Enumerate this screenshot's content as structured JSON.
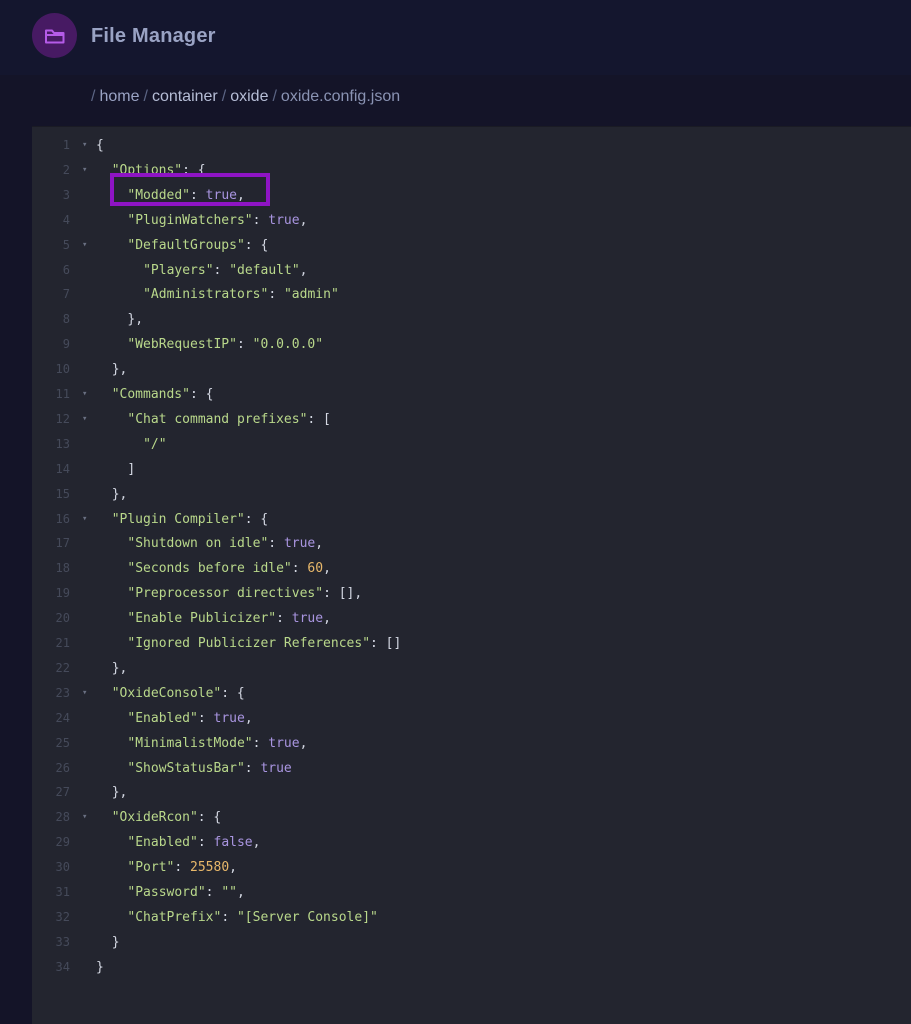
{
  "header": {
    "title": "File Manager",
    "icon": "folder-icon",
    "accent_color": "#471a63"
  },
  "breadcrumb": {
    "items": [
      "home",
      "container",
      "oxide"
    ],
    "current": "oxide.config.json",
    "separator": "/"
  },
  "editor": {
    "lines": [
      {
        "n": "1",
        "fold": true,
        "indent": 0,
        "tokens": [
          [
            "p",
            "{"
          ]
        ]
      },
      {
        "n": "2",
        "fold": true,
        "indent": 1,
        "tokens": [
          [
            "k",
            "\"Options\""
          ],
          [
            "p",
            ": {"
          ]
        ]
      },
      {
        "n": "3",
        "fold": false,
        "indent": 2,
        "tokens": [
          [
            "k",
            "\"Modded\""
          ],
          [
            "p",
            ": "
          ],
          [
            "b",
            "true"
          ],
          [
            "p",
            ","
          ]
        ]
      },
      {
        "n": "4",
        "fold": false,
        "indent": 2,
        "tokens": [
          [
            "k",
            "\"PluginWatchers\""
          ],
          [
            "p",
            ": "
          ],
          [
            "b",
            "true"
          ],
          [
            "p",
            ","
          ]
        ]
      },
      {
        "n": "5",
        "fold": true,
        "indent": 2,
        "tokens": [
          [
            "k",
            "\"DefaultGroups\""
          ],
          [
            "p",
            ": {"
          ]
        ]
      },
      {
        "n": "6",
        "fold": false,
        "indent": 3,
        "tokens": [
          [
            "k",
            "\"Players\""
          ],
          [
            "p",
            ": "
          ],
          [
            "s",
            "\"default\""
          ],
          [
            "p",
            ","
          ]
        ]
      },
      {
        "n": "7",
        "fold": false,
        "indent": 3,
        "tokens": [
          [
            "k",
            "\"Administrators\""
          ],
          [
            "p",
            ": "
          ],
          [
            "s",
            "\"admin\""
          ]
        ]
      },
      {
        "n": "8",
        "fold": false,
        "indent": 2,
        "tokens": [
          [
            "p",
            "},"
          ]
        ]
      },
      {
        "n": "9",
        "fold": false,
        "indent": 2,
        "tokens": [
          [
            "k",
            "\"WebRequestIP\""
          ],
          [
            "p",
            ": "
          ],
          [
            "s",
            "\"0.0.0.0\""
          ]
        ]
      },
      {
        "n": "10",
        "fold": false,
        "indent": 1,
        "tokens": [
          [
            "p",
            "},"
          ]
        ]
      },
      {
        "n": "11",
        "fold": true,
        "indent": 1,
        "tokens": [
          [
            "k",
            "\"Commands\""
          ],
          [
            "p",
            ": {"
          ]
        ]
      },
      {
        "n": "12",
        "fold": true,
        "indent": 2,
        "tokens": [
          [
            "k",
            "\"Chat command prefixes\""
          ],
          [
            "p",
            ": ["
          ]
        ]
      },
      {
        "n": "13",
        "fold": false,
        "indent": 3,
        "tokens": [
          [
            "s",
            "\"/\""
          ]
        ]
      },
      {
        "n": "14",
        "fold": false,
        "indent": 2,
        "tokens": [
          [
            "p",
            "]"
          ]
        ]
      },
      {
        "n": "15",
        "fold": false,
        "indent": 1,
        "tokens": [
          [
            "p",
            "},"
          ]
        ]
      },
      {
        "n": "16",
        "fold": true,
        "indent": 1,
        "tokens": [
          [
            "k",
            "\"Plugin Compiler\""
          ],
          [
            "p",
            ": {"
          ]
        ]
      },
      {
        "n": "17",
        "fold": false,
        "indent": 2,
        "tokens": [
          [
            "k",
            "\"Shutdown on idle\""
          ],
          [
            "p",
            ": "
          ],
          [
            "b",
            "true"
          ],
          [
            "p",
            ","
          ]
        ]
      },
      {
        "n": "18",
        "fold": false,
        "indent": 2,
        "tokens": [
          [
            "k",
            "\"Seconds before idle\""
          ],
          [
            "p",
            ": "
          ],
          [
            "n",
            "60"
          ],
          [
            "p",
            ","
          ]
        ]
      },
      {
        "n": "19",
        "fold": false,
        "indent": 2,
        "tokens": [
          [
            "k",
            "\"Preprocessor directives\""
          ],
          [
            "p",
            ": [],"
          ]
        ]
      },
      {
        "n": "20",
        "fold": false,
        "indent": 2,
        "tokens": [
          [
            "k",
            "\"Enable Publicizer\""
          ],
          [
            "p",
            ": "
          ],
          [
            "b",
            "true"
          ],
          [
            "p",
            ","
          ]
        ]
      },
      {
        "n": "21",
        "fold": false,
        "indent": 2,
        "tokens": [
          [
            "k",
            "\"Ignored Publicizer References\""
          ],
          [
            "p",
            ": []"
          ]
        ]
      },
      {
        "n": "22",
        "fold": false,
        "indent": 1,
        "tokens": [
          [
            "p",
            "},"
          ]
        ]
      },
      {
        "n": "23",
        "fold": true,
        "indent": 1,
        "tokens": [
          [
            "k",
            "\"OxideConsole\""
          ],
          [
            "p",
            ": {"
          ]
        ]
      },
      {
        "n": "24",
        "fold": false,
        "indent": 2,
        "tokens": [
          [
            "k",
            "\"Enabled\""
          ],
          [
            "p",
            ": "
          ],
          [
            "b",
            "true"
          ],
          [
            "p",
            ","
          ]
        ]
      },
      {
        "n": "25",
        "fold": false,
        "indent": 2,
        "tokens": [
          [
            "k",
            "\"MinimalistMode\""
          ],
          [
            "p",
            ": "
          ],
          [
            "b",
            "true"
          ],
          [
            "p",
            ","
          ]
        ]
      },
      {
        "n": "26",
        "fold": false,
        "indent": 2,
        "tokens": [
          [
            "k",
            "\"ShowStatusBar\""
          ],
          [
            "p",
            ": "
          ],
          [
            "b",
            "true"
          ]
        ]
      },
      {
        "n": "27",
        "fold": false,
        "indent": 1,
        "tokens": [
          [
            "p",
            "},"
          ]
        ]
      },
      {
        "n": "28",
        "fold": true,
        "indent": 1,
        "tokens": [
          [
            "k",
            "\"OxideRcon\""
          ],
          [
            "p",
            ": {"
          ]
        ]
      },
      {
        "n": "29",
        "fold": false,
        "indent": 2,
        "tokens": [
          [
            "k",
            "\"Enabled\""
          ],
          [
            "p",
            ": "
          ],
          [
            "b",
            "false"
          ],
          [
            "p",
            ","
          ]
        ]
      },
      {
        "n": "30",
        "fold": false,
        "indent": 2,
        "tokens": [
          [
            "k",
            "\"Port\""
          ],
          [
            "p",
            ": "
          ],
          [
            "n",
            "25580"
          ],
          [
            "p",
            ","
          ]
        ]
      },
      {
        "n": "31",
        "fold": false,
        "indent": 2,
        "tokens": [
          [
            "k",
            "\"Password\""
          ],
          [
            "p",
            ": "
          ],
          [
            "s",
            "\"\""
          ],
          [
            "p",
            ","
          ]
        ]
      },
      {
        "n": "32",
        "fold": false,
        "indent": 2,
        "tokens": [
          [
            "k",
            "\"ChatPrefix\""
          ],
          [
            "p",
            ": "
          ],
          [
            "s",
            "\"[Server Console]\""
          ]
        ]
      },
      {
        "n": "33",
        "fold": false,
        "indent": 1,
        "tokens": [
          [
            "p",
            "}"
          ]
        ]
      },
      {
        "n": "34",
        "fold": false,
        "indent": 0,
        "tokens": [
          [
            "p",
            "}"
          ]
        ]
      }
    ],
    "highlight_line": "3",
    "highlight_color": "#8e14c4"
  }
}
